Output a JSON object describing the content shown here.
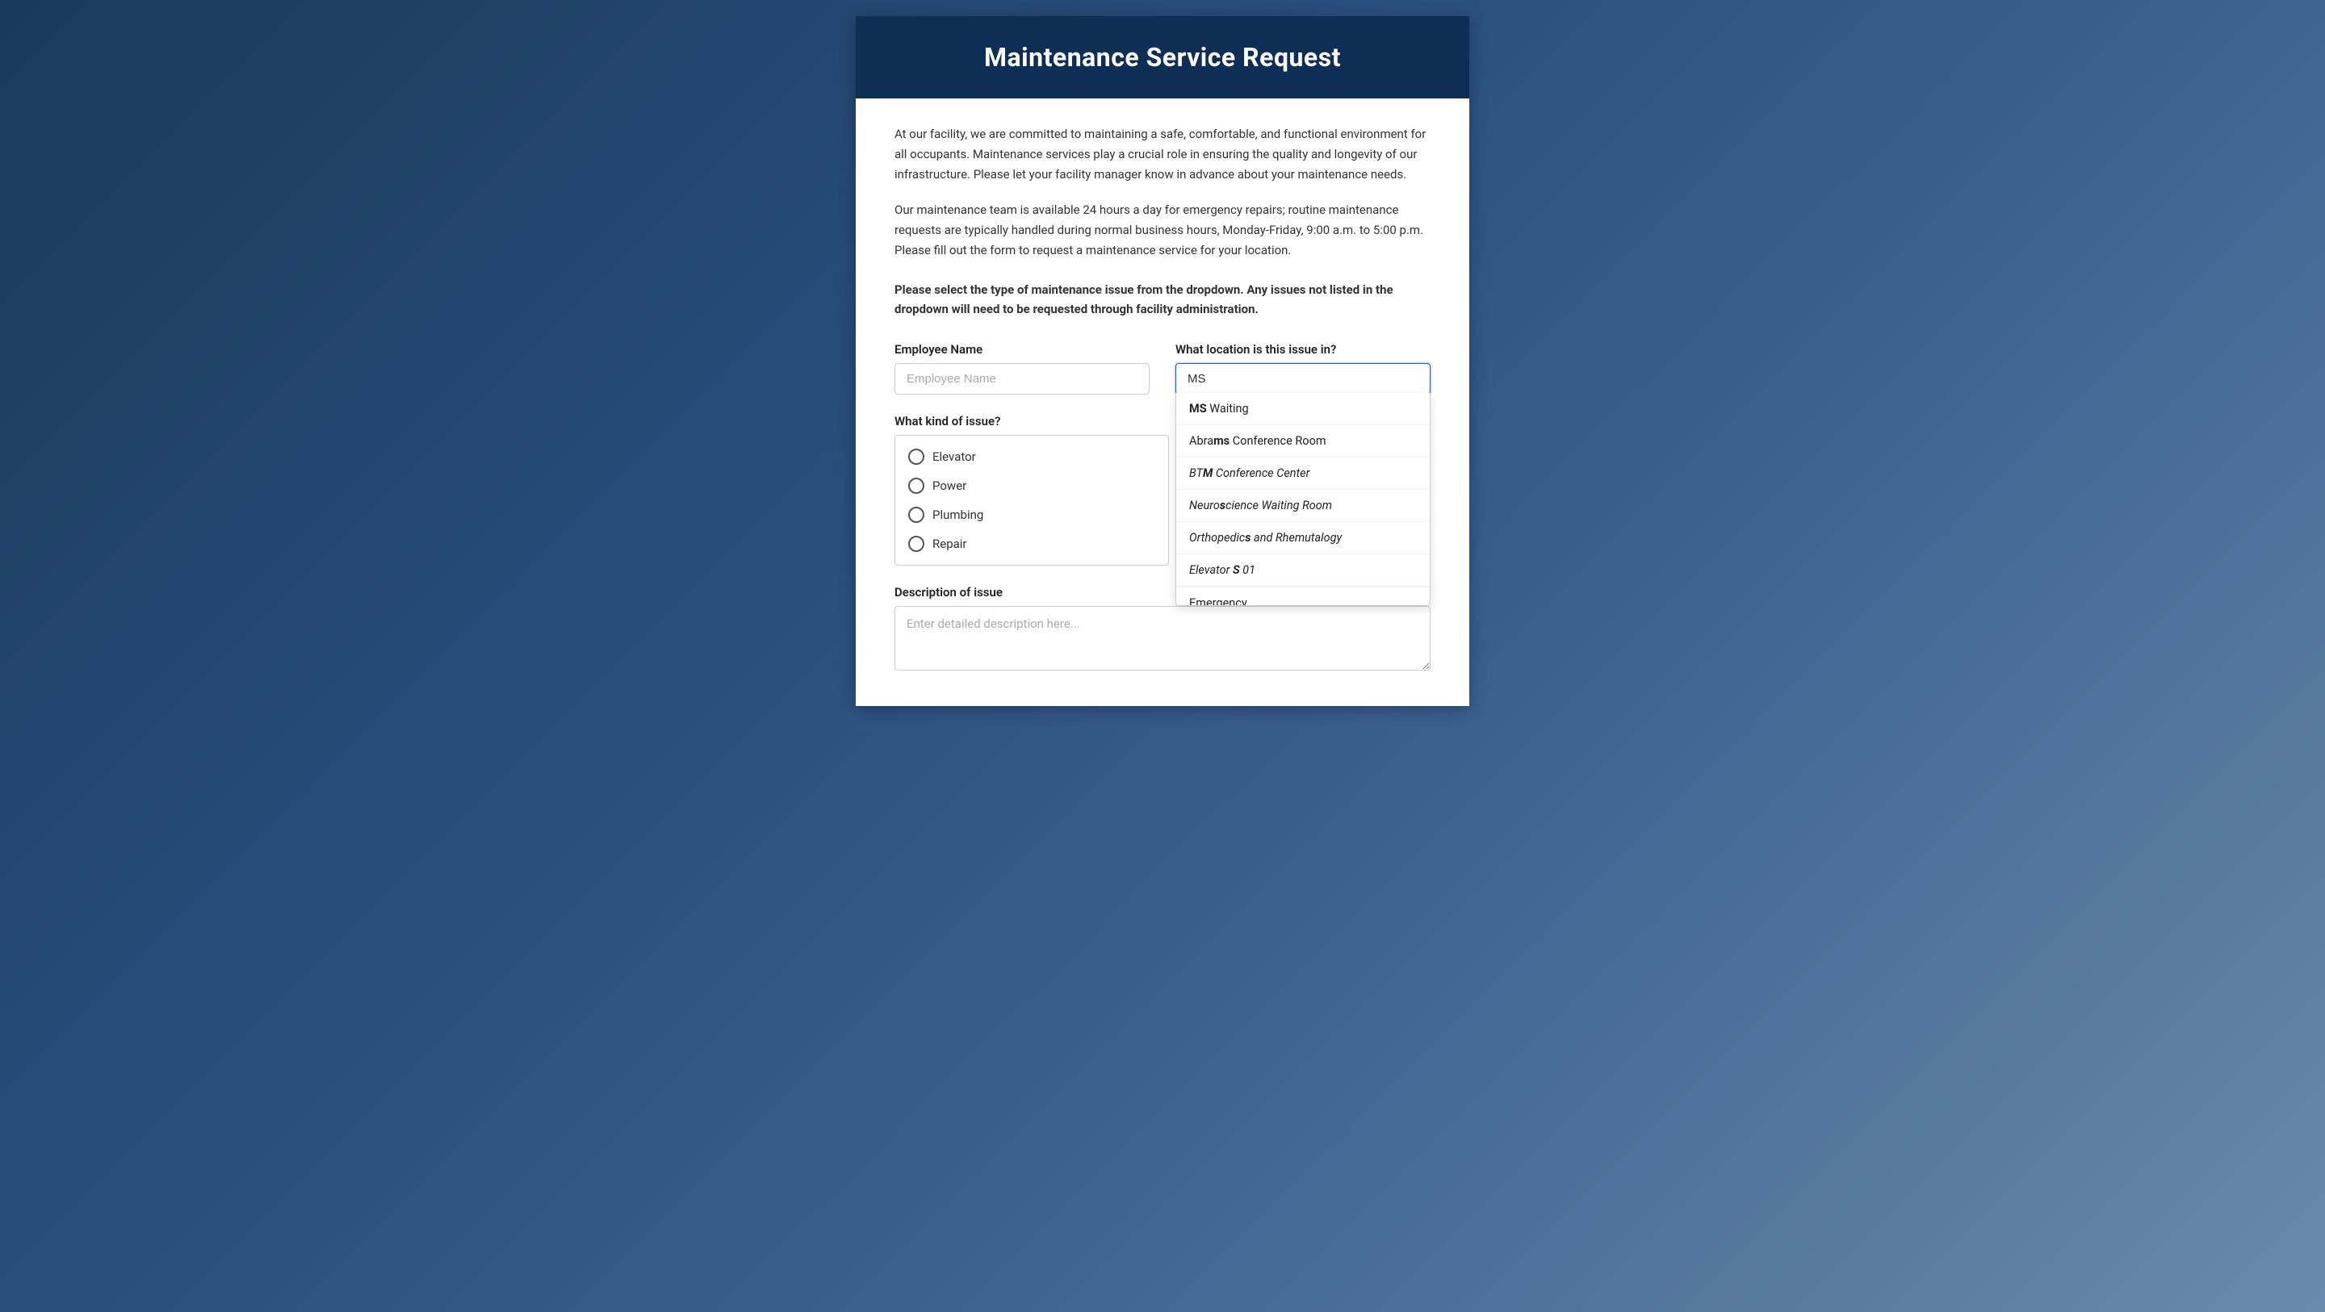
{
  "page": {
    "title": "Maintenance Service Request",
    "intro1": "At our facility, we are committed to maintaining a safe, comfortable, and functional environment for all occupants. Maintenance services play a crucial role in ensuring the quality and longevity of our infrastructure. Please let your facility manager know in advance about your maintenance needs.",
    "intro2": "Our maintenance team is available 24 hours a day for emergency repairs; routine maintenance requests are typically handled during normal business hours, Monday-Friday, 9:00 a.m. to 5:00 p.m. Please fill out the form to request a maintenance service for your location.",
    "important_text": "Please select the type of maintenance issue from the dropdown. Any issues not listed in the dropdown will need to be requested through facility administration.",
    "employee_name_label": "Employee Name",
    "employee_name_placeholder": "Employee Name",
    "location_label": "What location is this issue in?",
    "location_value": "MS",
    "issue_kind_label": "What kind of issue?",
    "issue_options": [
      {
        "label": "Elevator",
        "value": "elevator"
      },
      {
        "label": "Power",
        "value": "power"
      },
      {
        "label": "Plumbing",
        "value": "plumbing"
      },
      {
        "label": "Repair",
        "value": "repair"
      }
    ],
    "dropdown_options": [
      {
        "text": "MS Waiting",
        "highlight": "MS",
        "rest": " Waiting",
        "italic": false
      },
      {
        "text": "Abrams Conference Room",
        "highlight": "ms",
        "prefix": "Abra",
        "rest": " Conference Room",
        "italic": false
      },
      {
        "text": "BTM Conference Center",
        "highlight": "M",
        "prefix": "BT",
        "rest": " Conference Center",
        "italic": true
      },
      {
        "text": "Neuroscience Waiting Room",
        "highlight": "s",
        "prefix": "Neuro",
        "rest": "cience Waiting Room",
        "italic": true
      },
      {
        "text": "Orthopedics and Rhemutalogy",
        "highlight": "s",
        "prefix": "Orthopedic",
        "rest": " and Rhemutalogy",
        "italic": true
      },
      {
        "text": "Elevator S 01",
        "highlight": "S",
        "prefix": "Elevator ",
        "rest": " 01",
        "italic": true
      }
    ],
    "partial_item_text": "Emergency",
    "description_label": "Description of issue",
    "description_placeholder": "Enter detailed description here..."
  }
}
